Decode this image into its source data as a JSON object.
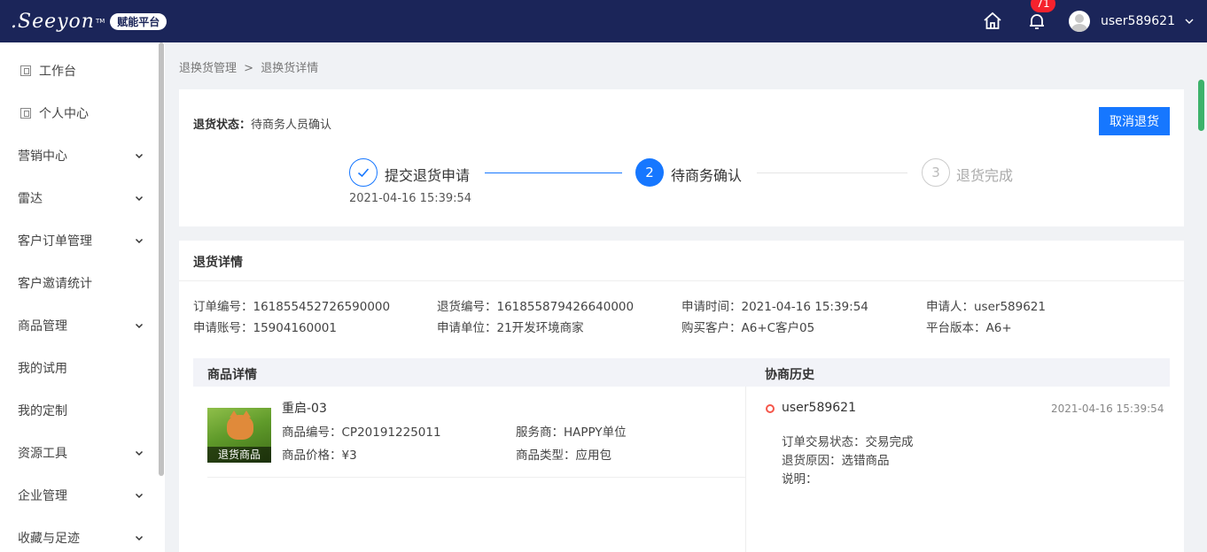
{
  "header": {
    "logo_text": ".Seeyon",
    "logo_tm": "TM",
    "logo_badge": "赋能平台",
    "notification_count": "71",
    "username": "user589621"
  },
  "sidebar": {
    "items": [
      {
        "label": "工作台",
        "icon": "page-icon",
        "expandable": false
      },
      {
        "label": "个人中心",
        "icon": "page-icon",
        "expandable": false
      },
      {
        "label": "营销中心",
        "expandable": true
      },
      {
        "label": "雷达",
        "expandable": true
      },
      {
        "label": "客户订单管理",
        "expandable": true
      },
      {
        "label": "客户邀请统计",
        "expandable": false
      },
      {
        "label": "商品管理",
        "expandable": true
      },
      {
        "label": "我的试用",
        "expandable": false
      },
      {
        "label": "我的定制",
        "expandable": false
      },
      {
        "label": "资源工具",
        "expandable": true
      },
      {
        "label": "企业管理",
        "expandable": true
      },
      {
        "label": "收藏与足迹",
        "expandable": true
      }
    ]
  },
  "breadcrumb": {
    "parent": "退换货管理",
    "separator": ">",
    "current": "退换货详情"
  },
  "status": {
    "label": "退货状态：",
    "value": "待商务人员确认",
    "cancel_button": "取消退货"
  },
  "steps": [
    {
      "number": "1",
      "label": "提交退货申请",
      "state": "done",
      "time": "2021-04-16 15:39:54"
    },
    {
      "number": "2",
      "label": "待商务确认",
      "state": "active"
    },
    {
      "number": "3",
      "label": "退货完成",
      "state": "pending"
    }
  ],
  "details": {
    "title": "退货详情",
    "order_no": "订单编号：161855452726590000",
    "return_no": "退货编号：161855879426640000",
    "apply_time": "申请时间：2021-04-16 15:39:54",
    "applicant": "申请人：user589621",
    "account": "申请账号：15904160001",
    "apply_unit": "申请单位：21开发环境商家",
    "customer": "购买客户：A6+C客户05",
    "platform": "平台版本：A6+"
  },
  "goods": {
    "header": "商品详情",
    "name": "重启-03",
    "thumb_label": "退货商品",
    "code": "商品编号：CP20191225011",
    "provider": "服务商：HAPPY单位",
    "price": "商品价格：¥3",
    "type": "商品类型：应用包"
  },
  "history": {
    "header": "协商历史",
    "user": "user589621",
    "time": "2021-04-16 15:39:54",
    "trade_status": "订单交易状态：交易完成",
    "reason": "退货原因：选错商品",
    "note": "说明："
  },
  "colors": {
    "topbar": "#1b2559",
    "primary": "#1677ff",
    "badge": "#f5222d",
    "history_dot": "#f5564a"
  }
}
